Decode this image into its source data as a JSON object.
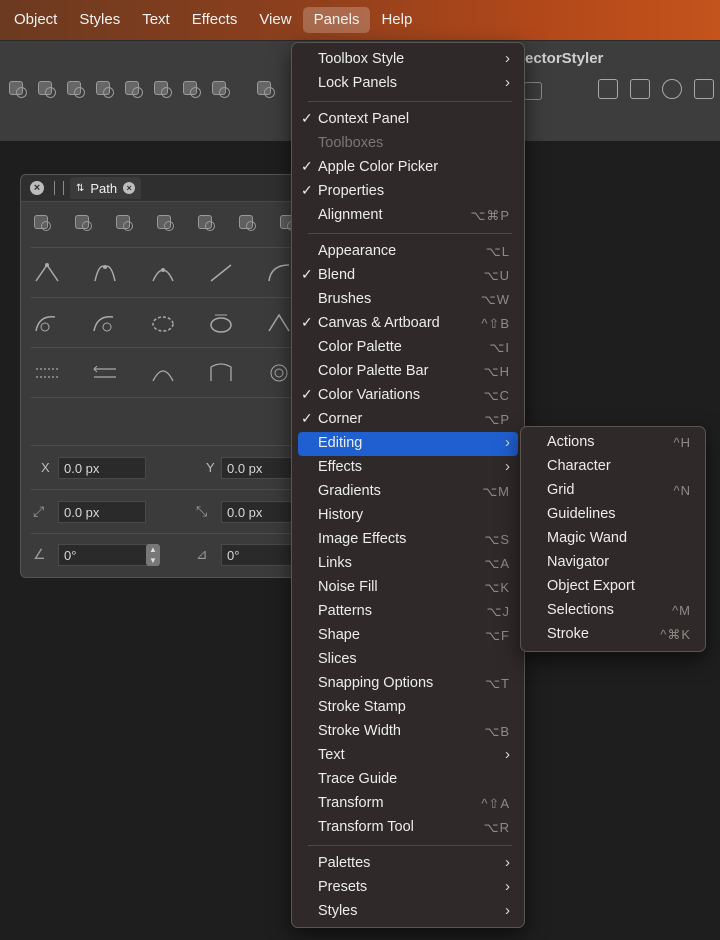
{
  "menubar": {
    "items": [
      {
        "label": "Object"
      },
      {
        "label": "Styles"
      },
      {
        "label": "Text"
      },
      {
        "label": "Effects"
      },
      {
        "label": "View"
      },
      {
        "label": "Panels"
      },
      {
        "label": "Help"
      }
    ],
    "active": "Panels"
  },
  "app": {
    "title": "ectorStyler"
  },
  "path_panel": {
    "tab_label": "Path",
    "x_label": "X",
    "x_value": "0.0 px",
    "y_label": "Y",
    "y_value": "0.0 px",
    "w_value": "0.0 px",
    "h_value": "0.0 px",
    "angle_value": "0°",
    "skew_value": "0°"
  },
  "panels_menu": {
    "items": [
      {
        "label": "Toolbox Style",
        "submenu": true
      },
      {
        "label": "Lock Panels",
        "submenu": true
      },
      {
        "sep": true
      },
      {
        "label": "Context Panel",
        "checked": true
      },
      {
        "label": "Toolboxes",
        "disabled": true
      },
      {
        "label": "Apple Color Picker",
        "checked": true
      },
      {
        "label": "Properties",
        "checked": true
      },
      {
        "label": "Alignment",
        "shortcut": "⌥⌘P"
      },
      {
        "sep": true
      },
      {
        "label": "Appearance",
        "shortcut": "⌥L"
      },
      {
        "label": "Blend",
        "checked": true,
        "shortcut": "⌥U"
      },
      {
        "label": "Brushes",
        "shortcut": "⌥W"
      },
      {
        "label": "Canvas & Artboard",
        "checked": true,
        "shortcut": "^⇧B"
      },
      {
        "label": "Color Palette",
        "shortcut": "⌥I"
      },
      {
        "label": "Color Palette Bar",
        "shortcut": "⌥H"
      },
      {
        "label": "Color Variations",
        "checked": true,
        "shortcut": "⌥C"
      },
      {
        "label": "Corner",
        "checked": true,
        "shortcut": "⌥P"
      },
      {
        "label": "Editing",
        "submenu": true,
        "highlighted": true
      },
      {
        "label": "Effects",
        "submenu": true
      },
      {
        "label": "Gradients",
        "shortcut": "⌥M"
      },
      {
        "label": "History"
      },
      {
        "label": "Image Effects",
        "shortcut": "⌥S"
      },
      {
        "label": "Links",
        "shortcut": "⌥A"
      },
      {
        "label": "Noise Fill",
        "shortcut": "⌥K"
      },
      {
        "label": "Patterns",
        "shortcut": "⌥J"
      },
      {
        "label": "Shape",
        "shortcut": "⌥F"
      },
      {
        "label": "Slices"
      },
      {
        "label": "Snapping Options",
        "shortcut": "⌥T"
      },
      {
        "label": "Stroke Stamp"
      },
      {
        "label": "Stroke Width",
        "shortcut": "⌥B"
      },
      {
        "label": "Text",
        "submenu": true
      },
      {
        "label": "Trace Guide"
      },
      {
        "label": "Transform",
        "shortcut": "^⇧A"
      },
      {
        "label": "Transform Tool",
        "shortcut": "⌥R"
      },
      {
        "sep": true
      },
      {
        "label": "Palettes",
        "submenu": true
      },
      {
        "label": "Presets",
        "submenu": true
      },
      {
        "label": "Styles",
        "submenu": true
      }
    ]
  },
  "editing_submenu": {
    "items": [
      {
        "label": "Actions",
        "shortcut": "^H"
      },
      {
        "label": "Character"
      },
      {
        "label": "Grid",
        "shortcut": "^N"
      },
      {
        "label": "Guidelines"
      },
      {
        "label": "Magic Wand"
      },
      {
        "label": "Navigator"
      },
      {
        "label": "Object Export"
      },
      {
        "label": "Selections",
        "shortcut": "^M"
      },
      {
        "label": "Stroke",
        "shortcut": "^⌘K"
      }
    ]
  },
  "glyphs": {
    "check": "✓",
    "arrow": "›",
    "close": "×",
    "updown": "⇅"
  },
  "colors": {
    "highlight": "#1f5fd0",
    "menubar_start": "#6b3a20",
    "menubar_end": "#c4531c",
    "menu_bg": "#2f2a29"
  }
}
